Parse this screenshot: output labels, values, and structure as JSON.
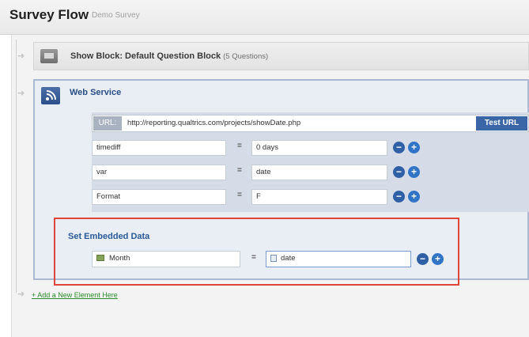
{
  "header": {
    "title": "Survey Flow",
    "subtitle": "Demo Survey"
  },
  "show_block": {
    "label": "Show Block: Default Question Block",
    "count": "(5 Questions)"
  },
  "web_service": {
    "title": "Web Service",
    "url_label": "URL:",
    "url_value": "http://reporting.qualtrics.com/projects/showDate.php",
    "test_button": "Test URL",
    "params": [
      {
        "key": "timediff",
        "equals": "=",
        "value": "0 days"
      },
      {
        "key": "var",
        "equals": "=",
        "value": "date"
      },
      {
        "key": "Format",
        "equals": "=",
        "value": "F"
      }
    ],
    "embedded": {
      "title": "Set Embedded Data",
      "key": "Month",
      "equals": "=",
      "value": "date"
    }
  },
  "buttons": {
    "minus": "−",
    "plus": "+"
  },
  "add_link": "+ Add a New Element Here",
  "colors": {
    "accent_blue": "#2f5fa5",
    "highlight_red": "#e0453a",
    "link_green": "#2a8a2a"
  },
  "icons": [
    "block-icon",
    "rss-icon",
    "embedded-data-icon",
    "piped-field-icon",
    "flow-arrow-icon"
  ]
}
